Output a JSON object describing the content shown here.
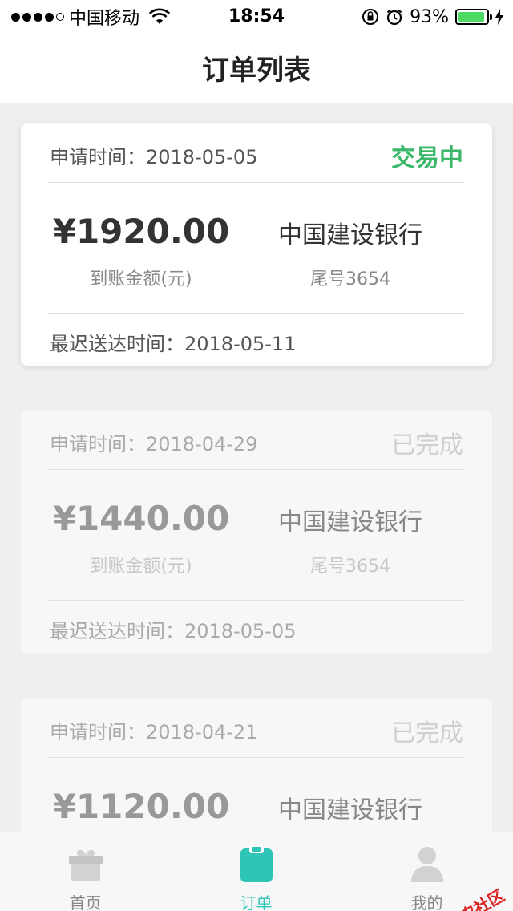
{
  "status_bar": {
    "carrier": "中国移动",
    "time": "18:54",
    "battery": "93%",
    "battery_level": 0.93,
    "signal_bars_filled": 4,
    "icons": [
      "wifi-icon",
      "orientation-lock-icon",
      "alarm-icon",
      "battery-icon",
      "charging-icon"
    ]
  },
  "nav": {
    "title": "订单列表"
  },
  "orders": [
    {
      "apply_time": "申请时间：2018-05-05",
      "status": "交易中",
      "amount": "¥1920.00",
      "amount_label": "到账金额(元)",
      "bank": "中国建设银行",
      "tail": "尾号3654",
      "arrive_time": "最迟送达时间：2018-05-11"
    },
    {
      "apply_time": "申请时间：2018-04-29",
      "status": "已完成",
      "amount": "¥1440.00",
      "amount_label": "到账金额(元)",
      "bank": "中国建设银行",
      "tail": "尾号3654",
      "arrive_time": "最迟送达时间：2018-05-05"
    },
    {
      "apply_time": "申请时间：2018-04-21",
      "status": "已完成",
      "amount": "¥1120.00",
      "bank": "中国建设银行"
    }
  ],
  "tabs": [
    {
      "label": "首页",
      "icon": "gift-box-icon"
    },
    {
      "label": "订单",
      "icon": "clipboard-icon"
    },
    {
      "label": "我的",
      "icon": "person-icon"
    }
  ],
  "watermark": {
    "text": "卡农社区"
  },
  "colors": {
    "accent": "#2ec4b6",
    "status_active": "#3bb86a",
    "battery": "#4cd964",
    "watermark": "#dd2222"
  }
}
